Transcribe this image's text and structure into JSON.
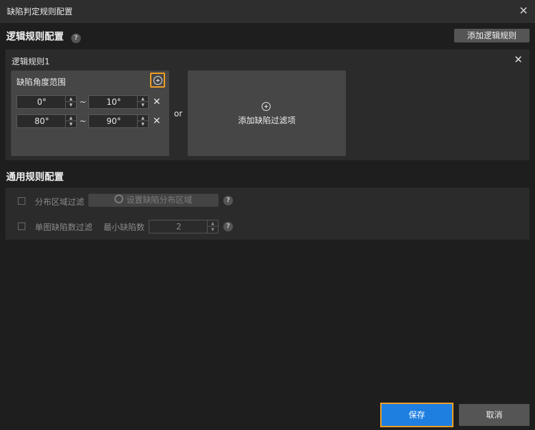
{
  "window": {
    "title": "缺陷判定规则配置",
    "close_icon": "close-icon"
  },
  "logic_section": {
    "title": "逻辑规则配置",
    "help": "?",
    "add_button": "添加逻辑规则"
  },
  "rule1": {
    "title": "逻辑规则1",
    "angle_card": {
      "title": "缺陷角度范围",
      "ranges": [
        {
          "min": "0°",
          "max": "10°"
        },
        {
          "min": "80°",
          "max": "90°"
        }
      ],
      "separator": "~",
      "remove": "✕"
    },
    "or_label": "or",
    "add_filter_label": "添加缺陷过滤项"
  },
  "general_section": {
    "title": "通用规则配置",
    "region_filter": {
      "label": "分布区域过滤",
      "button": "设置缺陷分布区域",
      "help": "?"
    },
    "count_filter": {
      "label": "单图缺陷数过滤",
      "min_label": "最小缺陷数",
      "min_value": "2",
      "help": "?"
    }
  },
  "footer": {
    "save": "保存",
    "cancel": "取消"
  },
  "colors": {
    "accent": "#1f7fe0",
    "highlight": "#f0a024"
  }
}
